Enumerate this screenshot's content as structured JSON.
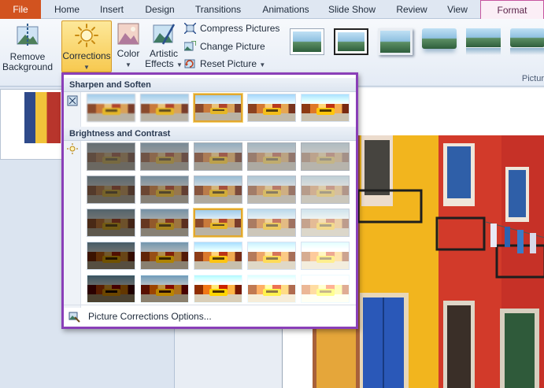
{
  "tabs": [
    "File",
    "Home",
    "Insert",
    "Design",
    "Transitions",
    "Animations",
    "Slide Show",
    "Review",
    "View",
    "Format"
  ],
  "ribbon": {
    "remove_background": [
      "Remove",
      "Background"
    ],
    "corrections": "Corrections",
    "color": "Color",
    "artistic_effects": [
      "Artistic",
      "Effects"
    ],
    "compress": "Compress Pictures",
    "change": "Change Picture",
    "reset": "Reset Picture",
    "group_label": "Pictur"
  },
  "dropdown": {
    "sharpen_title": "Sharpen and Soften",
    "brightness_title": "Brightness and Contrast",
    "options_label": "Picture Corrections Options...",
    "sharpen_selected_index": 2,
    "brightness_selected": [
      2,
      2
    ]
  },
  "icons": {
    "sharpen": "sharpen-icon",
    "brightness": "sun-icon",
    "options": "picture-corrections-options-icon"
  },
  "colors": {
    "file_tab": "#d2531f",
    "highlight_border": "#8a3fb8",
    "selection": "#e1a72f"
  }
}
